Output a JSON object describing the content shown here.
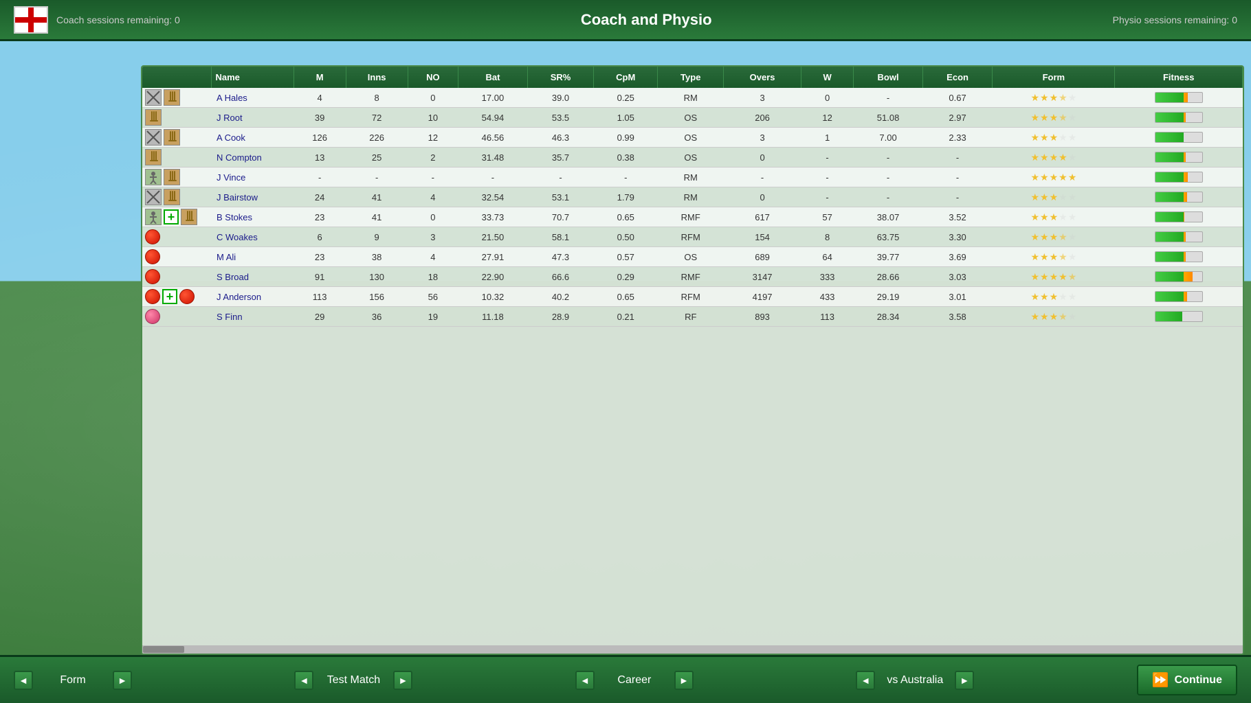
{
  "header": {
    "title": "Coach and Physio",
    "coach_sessions": "Coach sessions remaining: 0",
    "physio_sessions": "Physio sessions remaining: 0"
  },
  "table": {
    "columns": [
      "",
      "M",
      "Inns",
      "NO",
      "Bat",
      "SR%",
      "CpM",
      "Type",
      "Overs",
      "W",
      "Bowl",
      "Econ",
      "Form",
      "Fitness"
    ],
    "rows": [
      {
        "name": "A Hales",
        "m": "4",
        "inns": "8",
        "no": "0",
        "bat": "17.00",
        "sr": "39.0",
        "cpm": "0.25",
        "type": "RM",
        "overs": "3",
        "w": "0",
        "bowl": "-",
        "econ": "0.67",
        "form_stars": 3.5,
        "fitness": 70,
        "icons": [
          "crossed-bat",
          "wicket-bat"
        ]
      },
      {
        "name": "J Root",
        "m": "39",
        "inns": "72",
        "no": "10",
        "bat": "54.94",
        "sr": "53.5",
        "cpm": "1.05",
        "type": "OS",
        "overs": "206",
        "w": "12",
        "bowl": "51.08",
        "econ": "2.97",
        "form_stars": 3.5,
        "fitness": 65,
        "icons": [
          "wicket-bat"
        ]
      },
      {
        "name": "A Cook",
        "m": "126",
        "inns": "226",
        "no": "12",
        "bat": "46.56",
        "sr": "46.3",
        "cpm": "0.99",
        "type": "OS",
        "overs": "3",
        "w": "1",
        "bowl": "7.00",
        "econ": "2.33",
        "form_stars": 3,
        "fitness": 60,
        "icons": [
          "crossed-bat",
          "wicket-bat"
        ]
      },
      {
        "name": "N Compton",
        "m": "13",
        "inns": "25",
        "no": "2",
        "bat": "31.48",
        "sr": "35.7",
        "cpm": "0.38",
        "type": "OS",
        "overs": "0",
        "w": "-",
        "bowl": "-",
        "econ": "-",
        "form_stars": 4,
        "fitness": 65,
        "icons": [
          "wicket-bat"
        ]
      },
      {
        "name": "J Vince",
        "m": "-",
        "inns": "-",
        "no": "-",
        "bat": "-",
        "sr": "-",
        "cpm": "-",
        "type": "RM",
        "overs": "-",
        "w": "-",
        "bowl": "-",
        "econ": "-",
        "form_stars": 5,
        "fitness": 70,
        "icons": [
          "fielding",
          "wicket-bat"
        ]
      },
      {
        "name": "J Bairstow",
        "m": "24",
        "inns": "41",
        "no": "4",
        "bat": "32.54",
        "sr": "53.1",
        "cpm": "1.79",
        "type": "RM",
        "overs": "0",
        "w": "-",
        "bowl": "-",
        "econ": "-",
        "form_stars": 3,
        "fitness": 68,
        "icons": [
          "crossed-bat",
          "wicket-bat"
        ]
      },
      {
        "name": "B Stokes",
        "m": "23",
        "inns": "41",
        "no": "0",
        "bat": "33.73",
        "sr": "70.7",
        "cpm": "0.65",
        "type": "RMF",
        "overs": "617",
        "w": "57",
        "bowl": "38.07",
        "econ": "3.52",
        "form_stars": 3,
        "fitness": 62,
        "icons": [
          "fielding",
          "plus",
          "wicket-bat"
        ]
      },
      {
        "name": "C Woakes",
        "m": "6",
        "inns": "9",
        "no": "3",
        "bat": "21.50",
        "sr": "58.1",
        "cpm": "0.50",
        "type": "RFM",
        "overs": "154",
        "w": "8",
        "bowl": "63.75",
        "econ": "3.30",
        "form_stars": 3.5,
        "fitness": 65,
        "icons": [
          "ball-red"
        ]
      },
      {
        "name": "M Ali",
        "m": "23",
        "inns": "38",
        "no": "4",
        "bat": "27.91",
        "sr": "47.3",
        "cpm": "0.57",
        "type": "OS",
        "overs": "689",
        "w": "64",
        "bowl": "39.77",
        "econ": "3.69",
        "form_stars": 3.5,
        "fitness": 65,
        "icons": [
          "ball-red"
        ]
      },
      {
        "name": "S Broad",
        "m": "91",
        "inns": "130",
        "no": "18",
        "bat": "22.90",
        "sr": "66.6",
        "cpm": "0.29",
        "type": "RMF",
        "overs": "3147",
        "w": "333",
        "bowl": "28.66",
        "econ": "3.03",
        "form_stars": 4.5,
        "fitness": 80,
        "icons": [
          "ball-red"
        ]
      },
      {
        "name": "J Anderson",
        "m": "113",
        "inns": "156",
        "no": "56",
        "bat": "10.32",
        "sr": "40.2",
        "cpm": "0.65",
        "type": "RFM",
        "overs": "4197",
        "w": "433",
        "bowl": "29.19",
        "econ": "3.01",
        "form_stars": 3,
        "fitness": 68,
        "icons": [
          "ball-red",
          "plus",
          "ball-red"
        ]
      },
      {
        "name": "S Finn",
        "m": "29",
        "inns": "36",
        "no": "19",
        "bat": "11.18",
        "sr": "28.9",
        "cpm": "0.21",
        "type": "RF",
        "overs": "893",
        "w": "113",
        "bowl": "28.34",
        "econ": "3.58",
        "form_stars": 3.5,
        "fitness": 58,
        "icons": [
          "ball-pink"
        ]
      }
    ]
  },
  "nav": {
    "form_label": "Form",
    "test_match_label": "Test Match",
    "career_label": "Career",
    "vs_label": "vs Australia",
    "continue_label": "Continue"
  }
}
